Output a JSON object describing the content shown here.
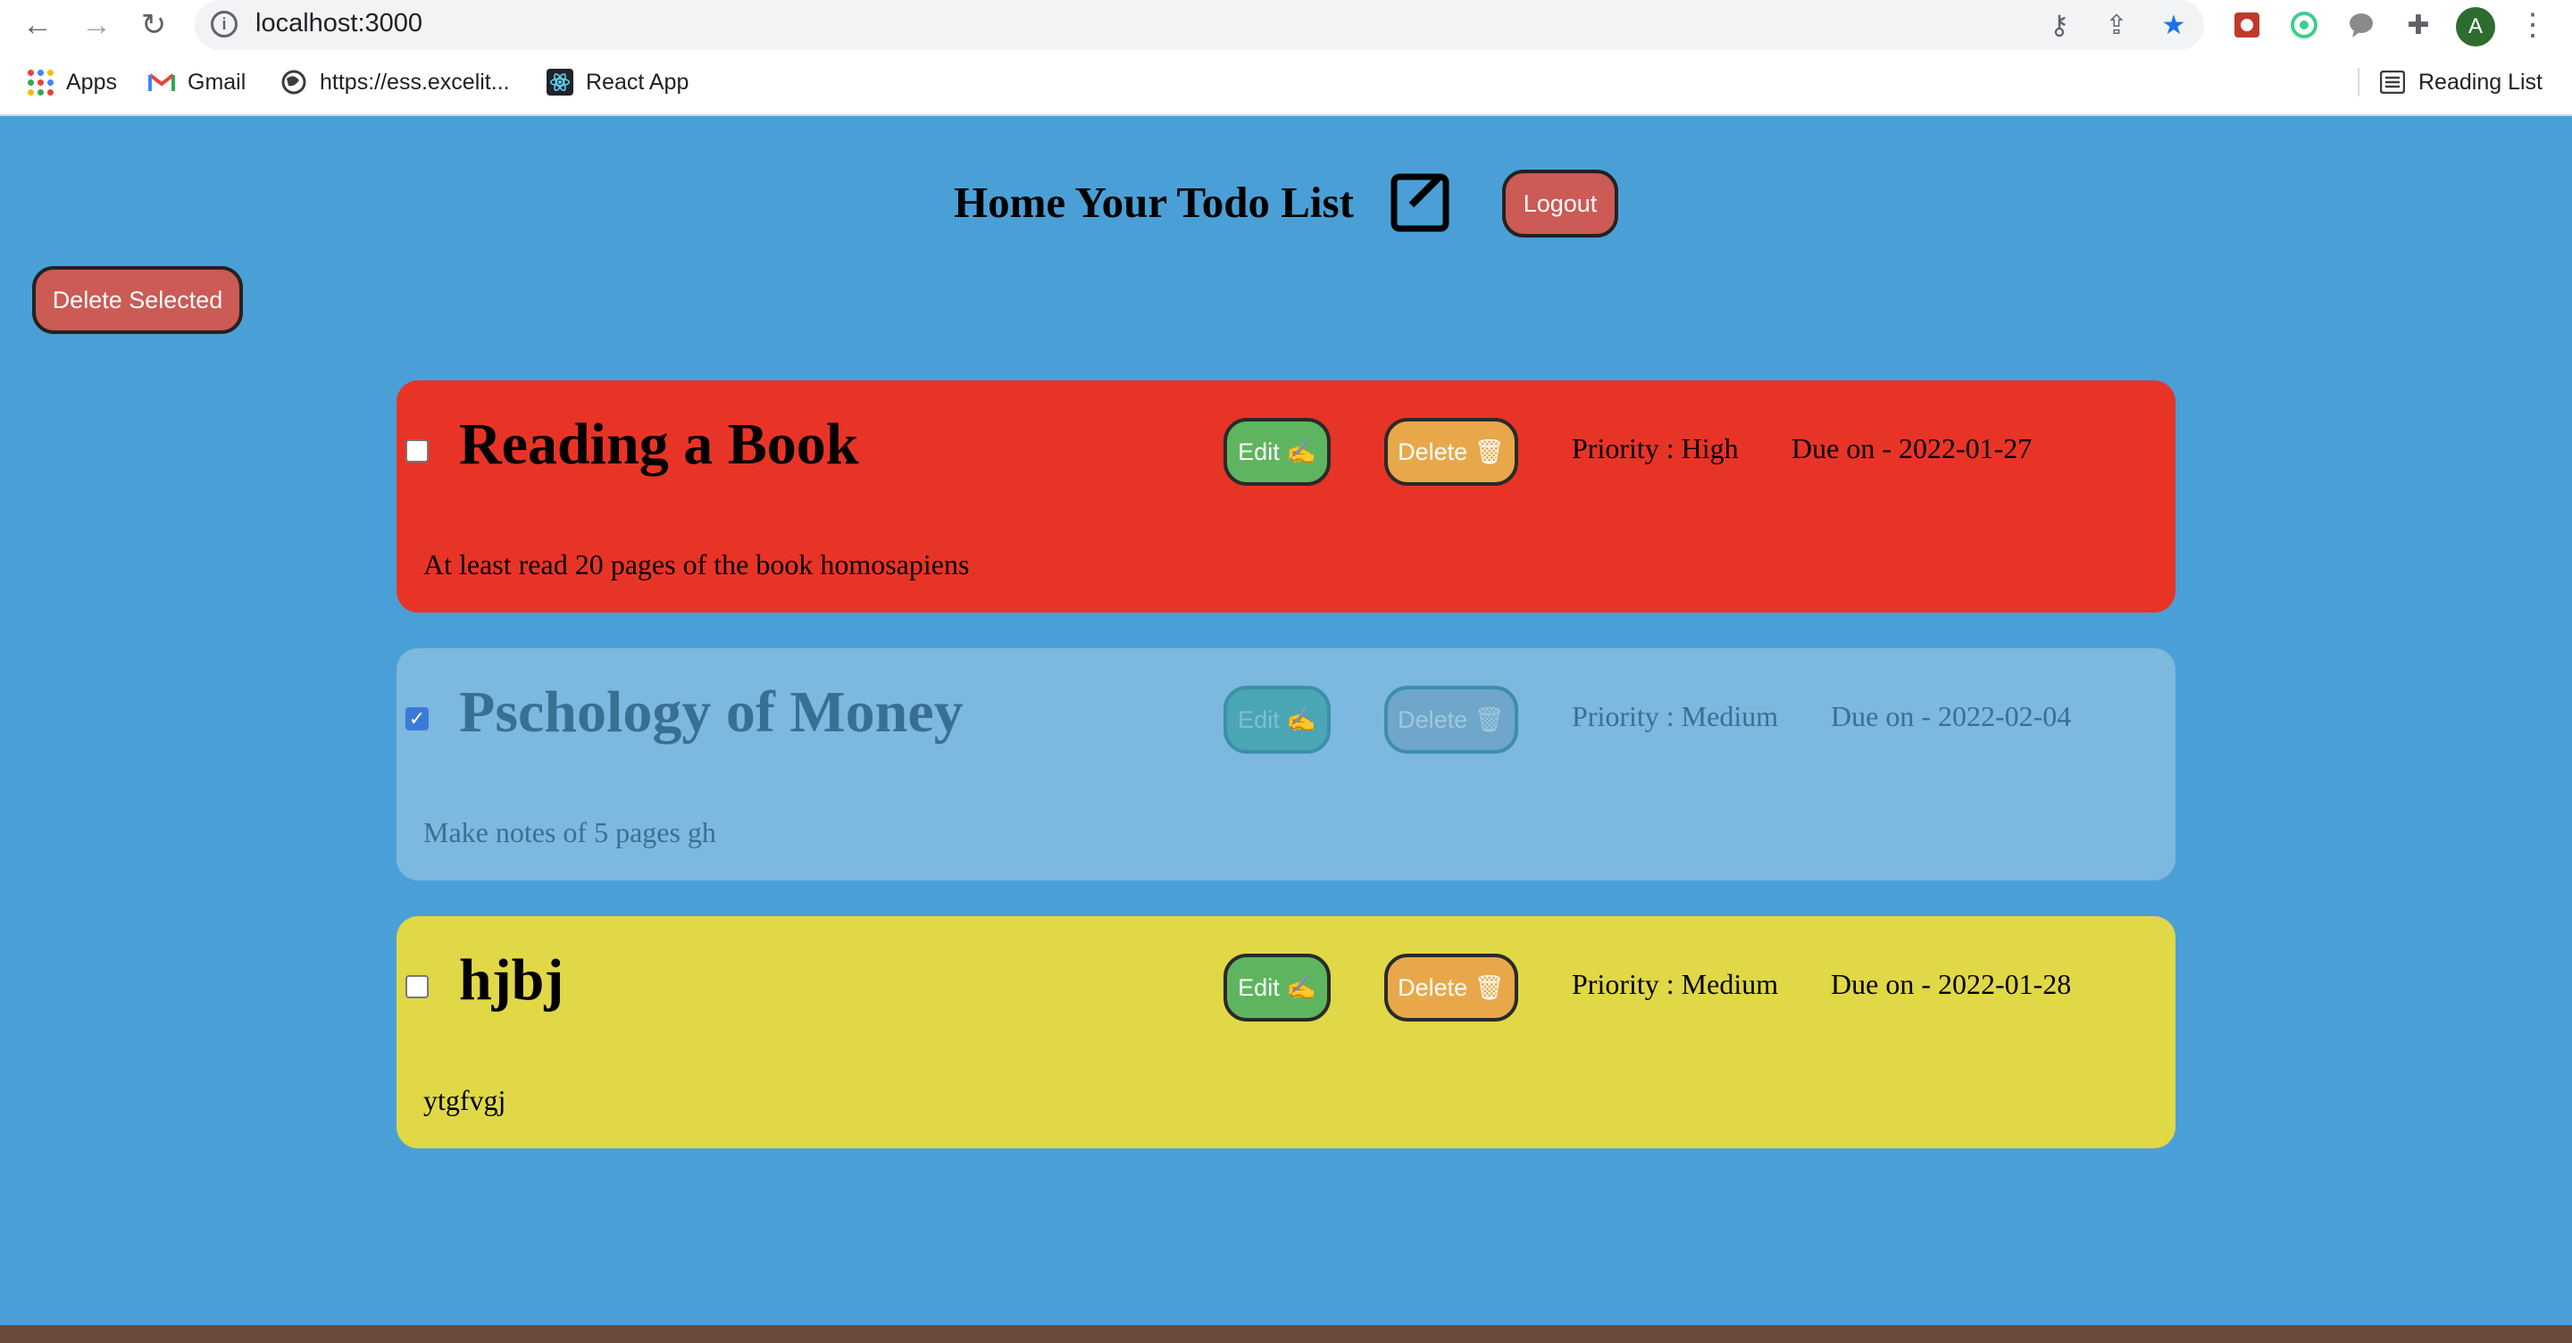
{
  "browser": {
    "url": "localhost:3000",
    "bookmarks": [
      {
        "label": "Apps"
      },
      {
        "label": "Gmail"
      },
      {
        "label": "https://ess.excelit..."
      },
      {
        "label": "React App"
      }
    ],
    "reading_list": "Reading List",
    "profile_initial": "A"
  },
  "header": {
    "title": "Home Your Todo List",
    "logout_label": "Logout"
  },
  "sidebar": {
    "delete_selected_label": "Delete Selected"
  },
  "todos": [
    {
      "title": "Reading a Book",
      "description": "At least read 20 pages of the book homosapiens",
      "priority": "Priority : High",
      "due": "Due on - 2022-01-27",
      "checked": false,
      "color": "#e83426",
      "edit_label": "Edit ✍",
      "delete_label": "Delete 🗑"
    },
    {
      "title": "Pschology of Money",
      "description": "Make notes of 5 pages gh",
      "priority": "Priority : Medium",
      "due": "Due on - 2022-02-04",
      "checked": true,
      "color": "#7db8de",
      "edit_label": "Edit ✍",
      "delete_label": "Delete 🗑"
    },
    {
      "title": "hjbj",
      "description": "ytgfvgj",
      "priority": "Priority : Medium",
      "due": "Due on - 2022-01-28",
      "checked": false,
      "color": "#e0d846",
      "edit_label": "Edit ✍",
      "delete_label": "Delete 🗑"
    }
  ],
  "colors": {
    "page_bg": "#4aa0d6",
    "red_button": "#cc5a55",
    "edit_button": "#5fb55f",
    "delete_button": "#e8a84a"
  }
}
